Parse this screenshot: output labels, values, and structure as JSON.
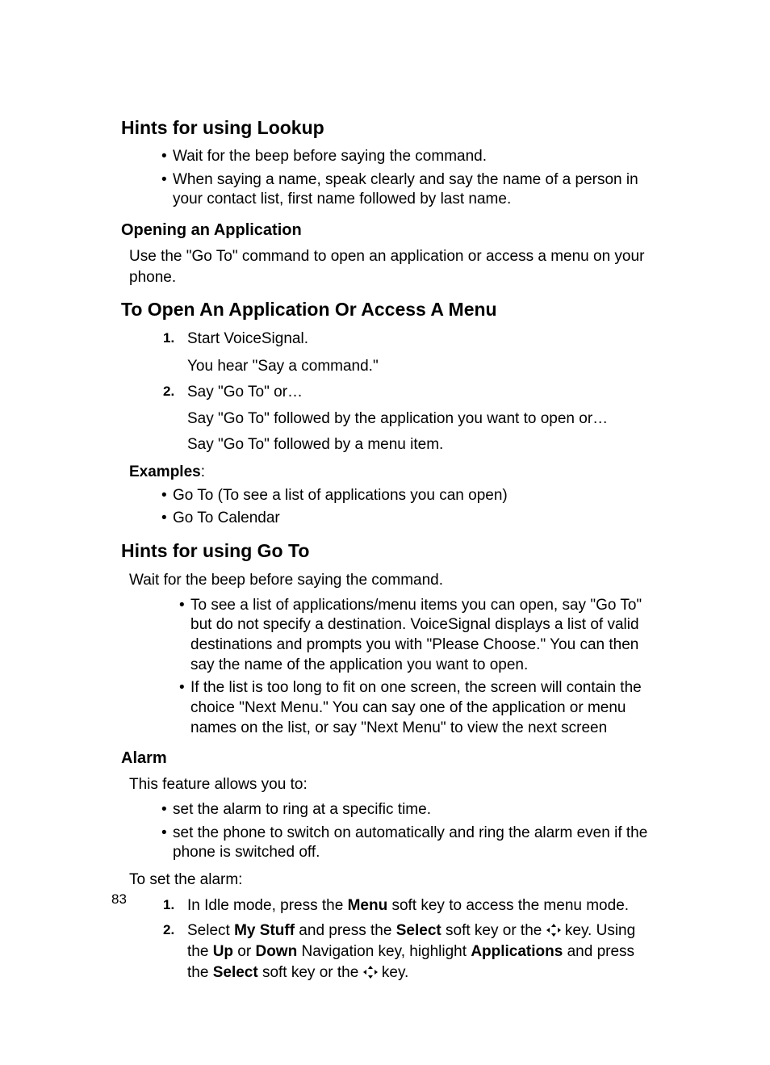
{
  "section1": {
    "title": "Hints for using Lookup",
    "bullets": [
      "Wait for the beep before saying the command.",
      "When saying a name, speak clearly and say the name of a person in your contact list, first name followed by last name."
    ]
  },
  "opening": {
    "title": "Opening an Application",
    "text": "Use the \"Go To\" command to open an application or access a menu on your phone."
  },
  "section2": {
    "title": "To Open An Application Or Access A Menu",
    "steps": {
      "n1": "1.",
      "s1": "Start VoiceSignal.",
      "s1a": "You hear \"Say a command.\"",
      "n2": "2.",
      "s2": "Say \"Go To\" or…",
      "s2a": "Say \"Go To\" followed by the application you want to open or…",
      "s2b": "Say \"Go To\" followed by a menu item."
    },
    "examples_label_bold": "Examples",
    "examples_label_colon": ":",
    "examples": [
      "Go To  (To see a list of applications you can open)",
      "Go To Calendar"
    ]
  },
  "section3": {
    "title": "Hints for using Go To",
    "intro": "Wait for the beep before saying the command.",
    "bullets": [
      "To see a list of applications/menu items you can open, say \"Go To\" but do not specify a destination. VoiceSignal displays a list of valid destinations and prompts you with \"Please Choose.\" You can then say the name of the application you want to open.",
      "If the list is too long to fit on one screen, the screen will contain the choice \"Next Menu.\" You can say one of the application or menu names on the list, or say \"Next Menu\" to view the next screen"
    ]
  },
  "alarm": {
    "title": "Alarm",
    "intro": "This feature allows you to:",
    "bullets": [
      "set the alarm to ring at a specific time.",
      "set the phone to switch on automatically and ring the alarm even if the phone is switched off."
    ],
    "to_set": "To set the alarm:",
    "steps": {
      "n1": "1.",
      "s1_a": "In Idle mode, press the ",
      "s1_menu": "Menu",
      "s1_b": " soft key to access the menu mode.",
      "n2": "2.",
      "s2_a": "Select ",
      "s2_mystuff": "My Stuff",
      "s2_b": " and press the ",
      "s2_select1": "Select",
      "s2_c": " soft key or the ",
      "s2_d": " key. Using the ",
      "s2_up": "Up",
      "s2_e": " or ",
      "s2_down": "Down",
      "s2_f": " Navigation key, highlight ",
      "s2_apps": "Applications",
      "s2_g": " and press the ",
      "s2_select2": "Select",
      "s2_h": " soft key or the ",
      "s2_i": " key."
    }
  },
  "page_number": "83"
}
